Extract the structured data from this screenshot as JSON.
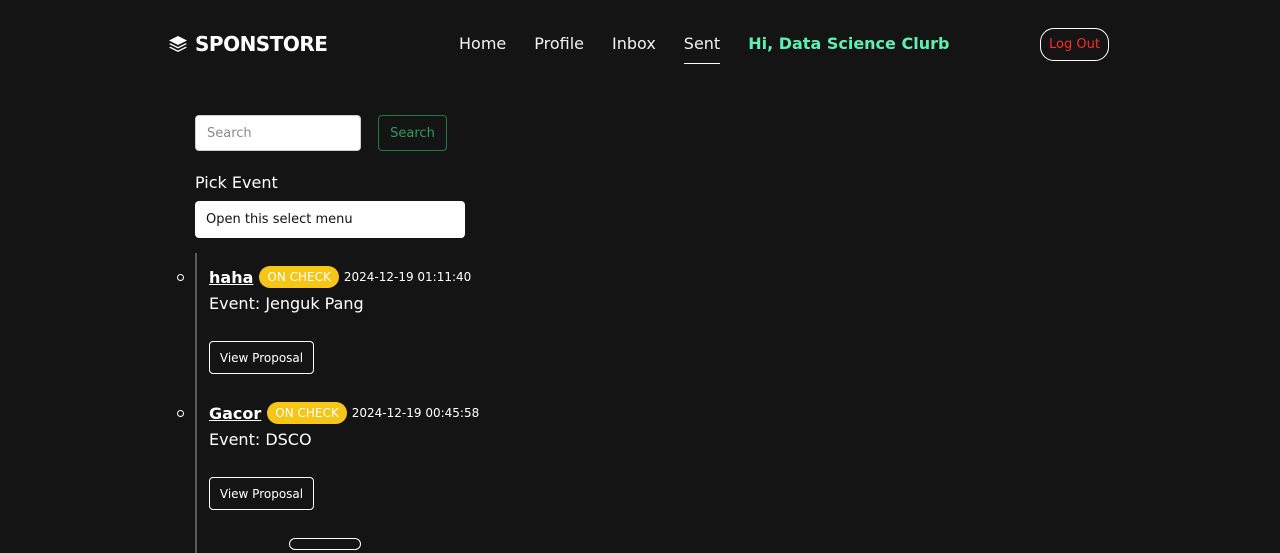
{
  "navbar": {
    "brand": "SPONSTORE",
    "brand_icon": "layers-icon",
    "links": [
      {
        "label": "Home",
        "active": false
      },
      {
        "label": "Profile",
        "active": false
      },
      {
        "label": "Inbox",
        "active": false
      },
      {
        "label": "Sent",
        "active": true
      }
    ],
    "greeting": "Hi, Data Science Clurb",
    "logout_label": "Log Out",
    "greeting_color": "#5ff0b1",
    "logout_color": "#ff2a2a"
  },
  "search": {
    "placeholder": "Search",
    "value": "",
    "button_label": "Search"
  },
  "filter": {
    "label": "Pick Event",
    "selected": "Open this select menu"
  },
  "proposals": [
    {
      "title": "haha",
      "status": "ON CHECK",
      "date": "2024-12-19 01:11:40",
      "event": "Event: Jenguk Pang",
      "button": "View Proposal"
    },
    {
      "title": "Gacor",
      "status": "ON CHECK",
      "date": "2024-12-19 00:45:58",
      "event": "Event: DSCO",
      "button": "View Proposal"
    }
  ],
  "status_color": "#f5c518"
}
